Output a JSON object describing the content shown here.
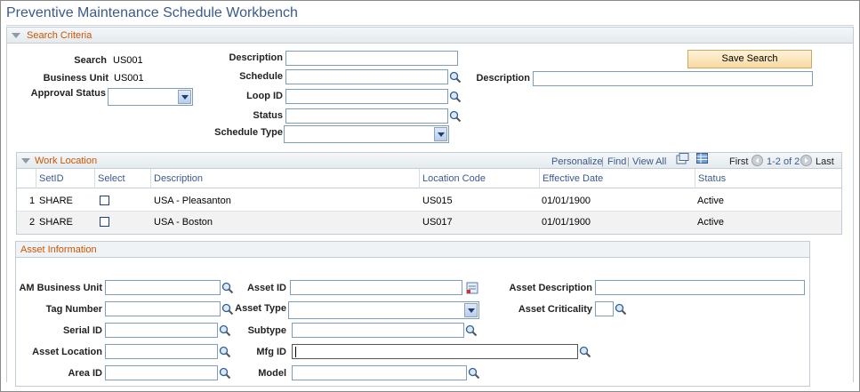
{
  "page": {
    "title": "Preventive Maintenance Schedule Workbench"
  },
  "search_criteria": {
    "header": "Search Criteria",
    "search_label": "Search",
    "search_value": "US001",
    "business_unit_label": "Business Unit",
    "business_unit_value": "US001",
    "approval_status_label": "Approval Status",
    "approval_status_value": "",
    "description_label": "Description",
    "description_value": "",
    "schedule_label": "Schedule",
    "schedule_value": "",
    "loop_id_label": "Loop ID",
    "loop_id_value": "",
    "status_label": "Status",
    "status_value": "",
    "schedule_type_label": "Schedule Type",
    "schedule_type_value": "",
    "schedule_description_label": "Description",
    "schedule_description_value": "",
    "save_search_label": "Save Search"
  },
  "work_location": {
    "header": "Work Location",
    "toolbar": {
      "personalize": "Personalize",
      "separator": "|",
      "find": "Find",
      "view_all": "View All",
      "first": "First",
      "range": "1-2 of 2",
      "last": "Last"
    },
    "columns": [
      "SetID",
      "Select",
      "Description",
      "Location Code",
      "Effective Date",
      "Status"
    ],
    "rows": [
      {
        "num": "1",
        "setid": "SHARE",
        "description": "USA - Pleasanton",
        "location_code": "US015",
        "effective_date": "01/01/1900",
        "status": "Active"
      },
      {
        "num": "2",
        "setid": "SHARE",
        "description": "USA - Boston",
        "location_code": "US017",
        "effective_date": "01/01/1900",
        "status": "Active"
      }
    ]
  },
  "asset_information": {
    "header": "Asset Information",
    "am_business_unit_label": "AM Business Unit",
    "tag_number_label": "Tag Number",
    "serial_id_label": "Serial ID",
    "asset_location_label": "Asset Location",
    "area_id_label": "Area ID",
    "asset_id_label": "Asset ID",
    "asset_type_label": "Asset Type",
    "subtype_label": "Subtype",
    "mfg_id_label": "Mfg ID",
    "model_label": "Model",
    "asset_description_label": "Asset Description",
    "asset_criticality_label": "Asset Criticality"
  },
  "colors": {
    "title": "#3a5a8c",
    "section_header": "#cc5500",
    "link": "#3a5a8c",
    "button_bg": "#f8d9a0"
  }
}
